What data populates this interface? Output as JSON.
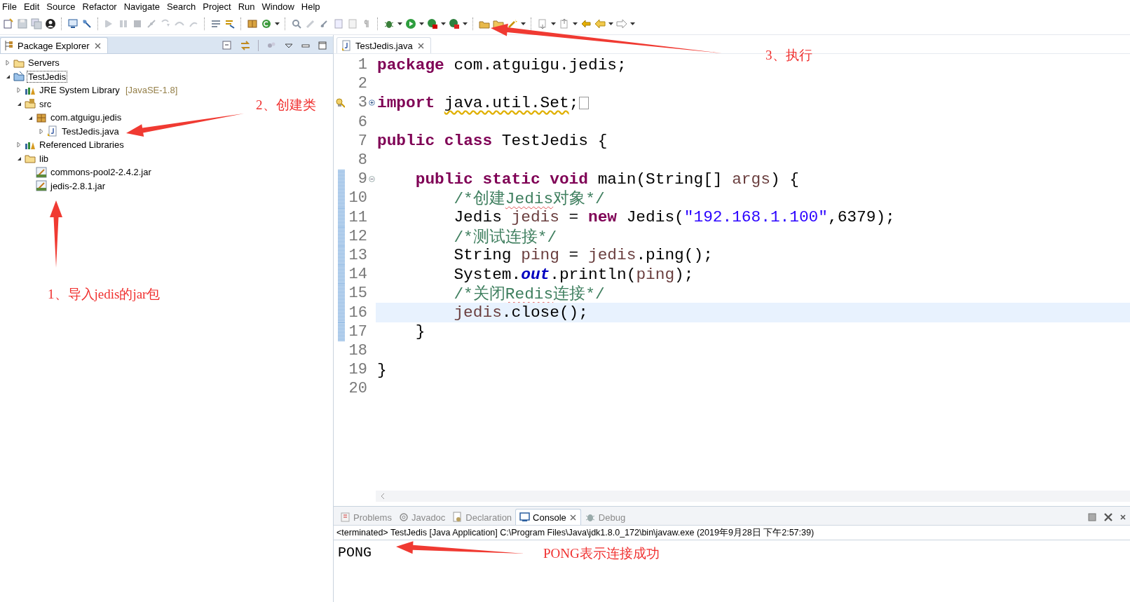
{
  "menu": [
    {
      "label": "File"
    },
    {
      "label": "Edit"
    },
    {
      "label": "Source"
    },
    {
      "label": "Refactor"
    },
    {
      "label": "Navigate"
    },
    {
      "label": "Search"
    },
    {
      "label": "Project"
    },
    {
      "label": "Run"
    },
    {
      "label": "Window"
    },
    {
      "label": "Help"
    }
  ],
  "explorer": {
    "tab": {
      "label": "Package Explorer"
    },
    "tree": [
      {
        "label": "Servers",
        "kind": "folder",
        "expanded": false,
        "selected": false
      },
      {
        "label": "TestJedis",
        "kind": "project",
        "expanded": true,
        "selected": true,
        "children": [
          {
            "label": "JRE System Library",
            "decoration": "[JavaSE-1.8]",
            "kind": "library",
            "expanded": false,
            "selected": false
          },
          {
            "label": "src",
            "kind": "source",
            "expanded": true,
            "selected": false,
            "children": [
              {
                "label": "com.atguigu.jedis",
                "kind": "package",
                "expanded": true,
                "selected": false,
                "children": [
                  {
                    "label": "TestJedis.java",
                    "kind": "java",
                    "expanded": false,
                    "selected": false
                  }
                ]
              }
            ]
          },
          {
            "label": "Referenced Libraries",
            "kind": "library",
            "expanded": false,
            "selected": false
          },
          {
            "label": "lib",
            "kind": "folder",
            "expanded": true,
            "selected": false,
            "children": [
              {
                "label": "commons-pool2-2.4.2.jar",
                "kind": "jar",
                "selected": false
              },
              {
                "label": "jedis-2.8.1.jar",
                "kind": "jar",
                "selected": false
              }
            ]
          }
        ]
      }
    ]
  },
  "editor": {
    "tab": {
      "label": "TestJedis.java"
    },
    "lines": [
      {
        "number": "1",
        "kind": "top",
        "changed": false,
        "current": false,
        "warning": false,
        "tokens": [
          {
            "kind": "keyword",
            "text": "package"
          },
          {
            "kind": "plain",
            "text": "com.atguigu.jedis;",
            "space": true
          }
        ]
      },
      {
        "number": "2",
        "kind": "top",
        "changed": false,
        "current": false,
        "warning": false
      },
      {
        "number": "3",
        "kind": "top",
        "changed": false,
        "current": false,
        "warning": true,
        "collapsed": true,
        "tokens": [
          {
            "kind": "keyword",
            "text": "import",
            "squiggly": false
          },
          {
            "kind": "plain",
            "text": "java.util.Set",
            "space": true,
            "squiggly": true
          },
          {
            "kind": "plain",
            "text": ";",
            "squiggly": false
          }
        ]
      },
      {
        "number": "6",
        "kind": "top",
        "changed": false,
        "current": false,
        "warning": false
      },
      {
        "number": "7",
        "kind": "top",
        "changed": false,
        "current": false,
        "warning": false,
        "tokens": [
          {
            "kind": "keyword",
            "text": "public"
          },
          {
            "kind": "keyword",
            "text": "class",
            "space": true
          },
          {
            "kind": "plain",
            "text": "TestJedis {",
            "space": true
          }
        ]
      },
      {
        "number": "8",
        "kind": "top",
        "changed": false,
        "current": false,
        "warning": false
      },
      {
        "number": "9",
        "kind": "member",
        "changed": true,
        "current": false,
        "warning": false,
        "collapsed": false,
        "tokens": [
          {
            "kind": "keyword",
            "text": "public"
          },
          {
            "kind": "keyword",
            "text": "static",
            "space": true
          },
          {
            "kind": "keyword",
            "text": "void",
            "space": true
          },
          {
            "kind": "plain",
            "text": "main(String[]",
            "space": true
          },
          {
            "kind": "local",
            "text": "args",
            "space": true
          },
          {
            "kind": "plain",
            "text": ") {"
          }
        ]
      },
      {
        "number": "10",
        "kind": "statement",
        "changed": true,
        "current": false,
        "warning": false,
        "tokens": [
          {
            "kind": "comment",
            "text": "/*创建",
            "squiggly": false
          },
          {
            "kind": "comment",
            "text": "Jedis",
            "squiggly": true
          },
          {
            "kind": "comment",
            "text": "对象*/",
            "squiggly": false
          }
        ]
      },
      {
        "number": "11",
        "kind": "statement",
        "changed": true,
        "current": false,
        "warning": false,
        "tokens": [
          {
            "kind": "plain",
            "text": "Jedis"
          },
          {
            "kind": "local",
            "text": "jedis",
            "space": true
          },
          {
            "kind": "plain",
            "text": "=",
            "space": true
          },
          {
            "kind": "keyword",
            "text": "new",
            "space": true
          },
          {
            "kind": "plain",
            "text": "Jedis(",
            "space": true
          },
          {
            "kind": "string",
            "text": "\"192.168.1.100\""
          },
          {
            "kind": "plain",
            "text": ",6379);"
          }
        ]
      },
      {
        "number": "12",
        "kind": "statement",
        "changed": true,
        "current": false,
        "warning": false,
        "tokens": [
          {
            "kind": "comment",
            "text": "/*测试连接*/"
          }
        ]
      },
      {
        "number": "13",
        "kind": "statement",
        "changed": true,
        "current": false,
        "warning": false,
        "tokens": [
          {
            "kind": "plain",
            "text": "String"
          },
          {
            "kind": "local",
            "text": "ping",
            "space": true
          },
          {
            "kind": "plain",
            "text": "=",
            "space": true
          },
          {
            "kind": "local",
            "text": "jedis",
            "space": true
          },
          {
            "kind": "plain",
            "text": ".ping();"
          }
        ]
      },
      {
        "number": "14",
        "kind": "statement",
        "changed": true,
        "current": false,
        "warning": false,
        "tokens": [
          {
            "kind": "plain",
            "text": "System."
          },
          {
            "kind": "field",
            "text": "out"
          },
          {
            "kind": "plain",
            "text": ".println("
          },
          {
            "kind": "local",
            "text": "ping"
          },
          {
            "kind": "plain",
            "text": ");"
          }
        ]
      },
      {
        "number": "15",
        "kind": "statement",
        "changed": true,
        "current": false,
        "warning": false,
        "tokens": [
          {
            "kind": "comment",
            "text": "/*关闭",
            "squiggly": false
          },
          {
            "kind": "comment",
            "text": "Redis",
            "squiggly": true
          },
          {
            "kind": "comment",
            "text": "连接*/",
            "squiggly": false
          }
        ]
      },
      {
        "number": "16",
        "kind": "statement",
        "changed": true,
        "current": true,
        "warning": false,
        "tokens": [
          {
            "kind": "local",
            "text": "jedis"
          },
          {
            "kind": "plain",
            "text": ".close();"
          }
        ]
      },
      {
        "number": "17",
        "kind": "member",
        "changed": true,
        "current": false,
        "warning": false,
        "tokens": [
          {
            "kind": "plain",
            "text": "}"
          }
        ]
      },
      {
        "number": "18",
        "kind": "top",
        "changed": false,
        "current": false,
        "warning": false
      },
      {
        "number": "19",
        "kind": "top",
        "changed": false,
        "current": false,
        "warning": false,
        "tokens": [
          {
            "kind": "plain",
            "text": "}"
          }
        ]
      },
      {
        "number": "20",
        "kind": "top",
        "changed": false,
        "current": false,
        "warning": false
      }
    ]
  },
  "console": {
    "tabs": [
      {
        "label": "Problems",
        "kind": "problems",
        "selected": false
      },
      {
        "label": "Javadoc",
        "kind": "javadoc",
        "selected": false
      },
      {
        "label": "Declaration",
        "kind": "declaration",
        "selected": false
      },
      {
        "label": "Console",
        "kind": "console",
        "selected": true
      },
      {
        "label": "Debug",
        "kind": "debug",
        "selected": false
      }
    ],
    "status": "<terminated> TestJedis [Java Application] C:\\Program Files\\Java\\jdk1.8.0_172\\bin\\javaw.exe (2019年9月28日 下午2:57:39)",
    "output": "PONG"
  },
  "annotations": [
    {
      "text": "3、执行"
    },
    {
      "text": "2、创建类"
    },
    {
      "text": "1、导入jedis的jar包"
    },
    {
      "text": "PONG表示连接成功"
    }
  ]
}
